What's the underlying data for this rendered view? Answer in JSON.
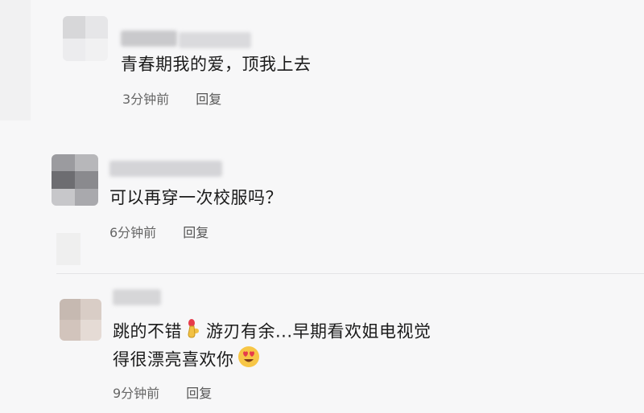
{
  "comments": [
    {
      "text": "青春期我的爱，顶我上去",
      "time": "3分钟前",
      "reply_label": "回复"
    },
    {
      "text": "可以再穿一次校服吗？",
      "time": "6分钟前",
      "reply_label": "回复"
    },
    {
      "text_line1_a": "跳的不错",
      "text_line1_b": "游刃有余...早期看欢姐电视觉",
      "text_line2": "得很漂亮喜欢你",
      "time": "9分钟前",
      "reply_label": "回复",
      "icons": [
        "pointing-hand-icon",
        "heart-eyes-icon"
      ]
    }
  ],
  "colors": {
    "background": "#f7f7f8",
    "text": "#1b1b1b",
    "meta": "#666666"
  }
}
